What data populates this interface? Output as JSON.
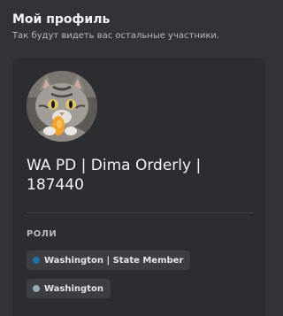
{
  "profile": {
    "title": "Мой профиль",
    "subtitle": "Так будут видеть вас остальные участники.",
    "display_name": "WA PD | Dima Orderly | 187440",
    "avatar_icon": "cat-photo-avatar"
  },
  "roles": {
    "heading": "РОЛИ",
    "items": [
      {
        "label": "Washington | State Member",
        "color": "#1f6fa8"
      },
      {
        "label": "Washington",
        "color": "#99aab5"
      }
    ]
  },
  "colors": {
    "background": "#313338",
    "card": "#2b2d31",
    "pill": "#3c3e44"
  }
}
